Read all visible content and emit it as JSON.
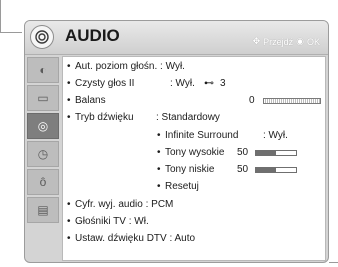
{
  "header": {
    "title": "AUDIO",
    "hint_nav": "Przejdź",
    "hint_ok": "OK"
  },
  "sidebar": {
    "items": [
      {
        "icon": "picture-icon"
      },
      {
        "icon": "tv-icon"
      },
      {
        "icon": "audio-icon",
        "active": true
      },
      {
        "icon": "clock-icon"
      },
      {
        "icon": "lock-icon"
      },
      {
        "icon": "options-icon"
      }
    ]
  },
  "menu": {
    "auto_volume_label": "Aut. poziom głośn.",
    "auto_volume_value": ": Wył.",
    "clear_voice_label": "Czysty głos II",
    "clear_voice_value": ": Wył.",
    "clear_voice_level": "3",
    "balance_label": "Balans",
    "balance_value": "0",
    "sound_mode_label": "Tryb dźwięku",
    "sound_mode_value": ": Standardowy",
    "infinite_surround_label": "Infinite Surround",
    "infinite_surround_value": ": Wył.",
    "treble_label": "Tony wysokie",
    "treble_value": "50",
    "treble_level": 0.5,
    "bass_label": "Tony niskie",
    "bass_value": "50",
    "bass_level": 0.5,
    "reset_label": "Resetuj",
    "digital_audio_label": "Cyfr. wyj. audio",
    "digital_audio_value": ": PCM",
    "tv_speaker_label": "Głośniki TV",
    "tv_speaker_value": ": Wł.",
    "dtv_audio_label": "Ustaw. dźwięku DTV",
    "dtv_audio_value": ": Auto"
  }
}
